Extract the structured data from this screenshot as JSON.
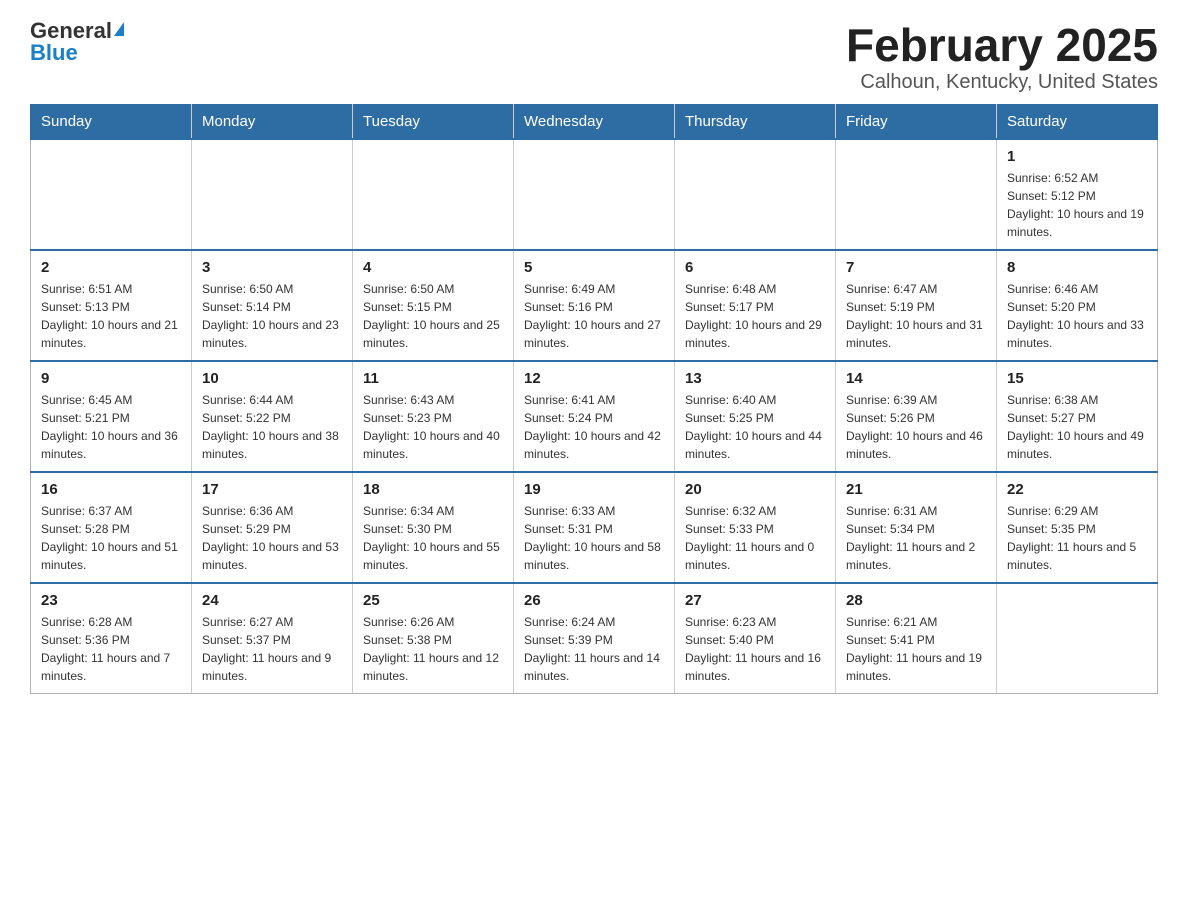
{
  "header": {
    "logo_general": "General",
    "logo_blue": "Blue",
    "month_title": "February 2025",
    "location": "Calhoun, Kentucky, United States"
  },
  "days_of_week": [
    "Sunday",
    "Monday",
    "Tuesday",
    "Wednesday",
    "Thursday",
    "Friday",
    "Saturday"
  ],
  "weeks": [
    [
      {
        "day": "",
        "info": ""
      },
      {
        "day": "",
        "info": ""
      },
      {
        "day": "",
        "info": ""
      },
      {
        "day": "",
        "info": ""
      },
      {
        "day": "",
        "info": ""
      },
      {
        "day": "",
        "info": ""
      },
      {
        "day": "1",
        "info": "Sunrise: 6:52 AM\nSunset: 5:12 PM\nDaylight: 10 hours and 19 minutes."
      }
    ],
    [
      {
        "day": "2",
        "info": "Sunrise: 6:51 AM\nSunset: 5:13 PM\nDaylight: 10 hours and 21 minutes."
      },
      {
        "day": "3",
        "info": "Sunrise: 6:50 AM\nSunset: 5:14 PM\nDaylight: 10 hours and 23 minutes."
      },
      {
        "day": "4",
        "info": "Sunrise: 6:50 AM\nSunset: 5:15 PM\nDaylight: 10 hours and 25 minutes."
      },
      {
        "day": "5",
        "info": "Sunrise: 6:49 AM\nSunset: 5:16 PM\nDaylight: 10 hours and 27 minutes."
      },
      {
        "day": "6",
        "info": "Sunrise: 6:48 AM\nSunset: 5:17 PM\nDaylight: 10 hours and 29 minutes."
      },
      {
        "day": "7",
        "info": "Sunrise: 6:47 AM\nSunset: 5:19 PM\nDaylight: 10 hours and 31 minutes."
      },
      {
        "day": "8",
        "info": "Sunrise: 6:46 AM\nSunset: 5:20 PM\nDaylight: 10 hours and 33 minutes."
      }
    ],
    [
      {
        "day": "9",
        "info": "Sunrise: 6:45 AM\nSunset: 5:21 PM\nDaylight: 10 hours and 36 minutes."
      },
      {
        "day": "10",
        "info": "Sunrise: 6:44 AM\nSunset: 5:22 PM\nDaylight: 10 hours and 38 minutes."
      },
      {
        "day": "11",
        "info": "Sunrise: 6:43 AM\nSunset: 5:23 PM\nDaylight: 10 hours and 40 minutes."
      },
      {
        "day": "12",
        "info": "Sunrise: 6:41 AM\nSunset: 5:24 PM\nDaylight: 10 hours and 42 minutes."
      },
      {
        "day": "13",
        "info": "Sunrise: 6:40 AM\nSunset: 5:25 PM\nDaylight: 10 hours and 44 minutes."
      },
      {
        "day": "14",
        "info": "Sunrise: 6:39 AM\nSunset: 5:26 PM\nDaylight: 10 hours and 46 minutes."
      },
      {
        "day": "15",
        "info": "Sunrise: 6:38 AM\nSunset: 5:27 PM\nDaylight: 10 hours and 49 minutes."
      }
    ],
    [
      {
        "day": "16",
        "info": "Sunrise: 6:37 AM\nSunset: 5:28 PM\nDaylight: 10 hours and 51 minutes."
      },
      {
        "day": "17",
        "info": "Sunrise: 6:36 AM\nSunset: 5:29 PM\nDaylight: 10 hours and 53 minutes."
      },
      {
        "day": "18",
        "info": "Sunrise: 6:34 AM\nSunset: 5:30 PM\nDaylight: 10 hours and 55 minutes."
      },
      {
        "day": "19",
        "info": "Sunrise: 6:33 AM\nSunset: 5:31 PM\nDaylight: 10 hours and 58 minutes."
      },
      {
        "day": "20",
        "info": "Sunrise: 6:32 AM\nSunset: 5:33 PM\nDaylight: 11 hours and 0 minutes."
      },
      {
        "day": "21",
        "info": "Sunrise: 6:31 AM\nSunset: 5:34 PM\nDaylight: 11 hours and 2 minutes."
      },
      {
        "day": "22",
        "info": "Sunrise: 6:29 AM\nSunset: 5:35 PM\nDaylight: 11 hours and 5 minutes."
      }
    ],
    [
      {
        "day": "23",
        "info": "Sunrise: 6:28 AM\nSunset: 5:36 PM\nDaylight: 11 hours and 7 minutes."
      },
      {
        "day": "24",
        "info": "Sunrise: 6:27 AM\nSunset: 5:37 PM\nDaylight: 11 hours and 9 minutes."
      },
      {
        "day": "25",
        "info": "Sunrise: 6:26 AM\nSunset: 5:38 PM\nDaylight: 11 hours and 12 minutes."
      },
      {
        "day": "26",
        "info": "Sunrise: 6:24 AM\nSunset: 5:39 PM\nDaylight: 11 hours and 14 minutes."
      },
      {
        "day": "27",
        "info": "Sunrise: 6:23 AM\nSunset: 5:40 PM\nDaylight: 11 hours and 16 minutes."
      },
      {
        "day": "28",
        "info": "Sunrise: 6:21 AM\nSunset: 5:41 PM\nDaylight: 11 hours and 19 minutes."
      },
      {
        "day": "",
        "info": ""
      }
    ]
  ]
}
